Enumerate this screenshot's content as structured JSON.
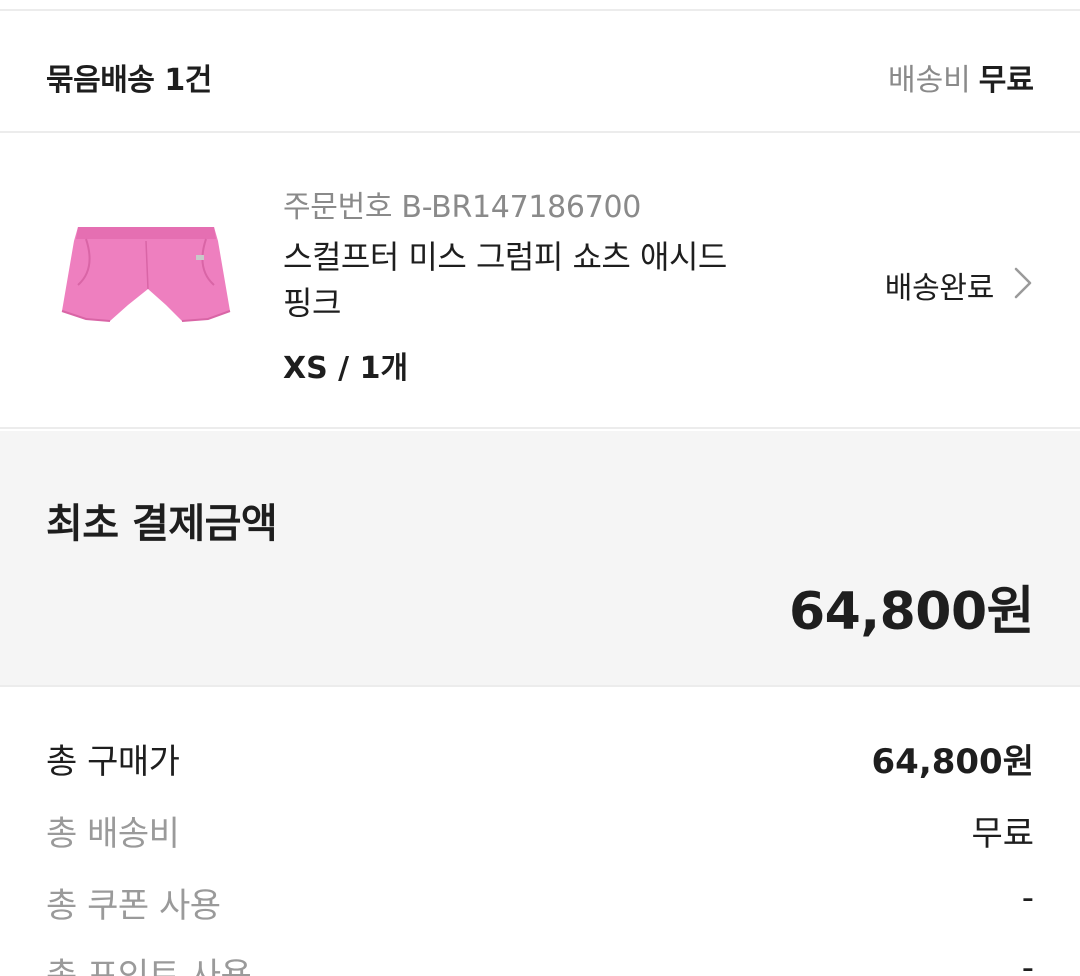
{
  "bundle": {
    "title": "묶음배송 1건",
    "shipping_label": "배송비",
    "shipping_value": "무료"
  },
  "product": {
    "order_number": "주문번호 B-BR147186700",
    "name": "스컬프터 미스 그럼피 쇼츠 애시드 핑크",
    "option": "XS / 1개",
    "status": "배송완료",
    "image_icon": "pink-shorts-image",
    "chevron_icon": "chevron-right-icon"
  },
  "payment": {
    "title": "최초 결제금액",
    "amount": "64,800원"
  },
  "details": [
    {
      "label": "총 구매가",
      "value": "64,800원"
    },
    {
      "label": "총 배송비",
      "value": "무료"
    },
    {
      "label": "총 쿠폰 사용",
      "value": "-"
    },
    {
      "label": "총 포인트 사용",
      "value": "-"
    }
  ],
  "colors": {
    "product_pink": "#ee7fbf",
    "muted_text": "#8a8a8a",
    "panel_bg": "#f5f5f5"
  }
}
